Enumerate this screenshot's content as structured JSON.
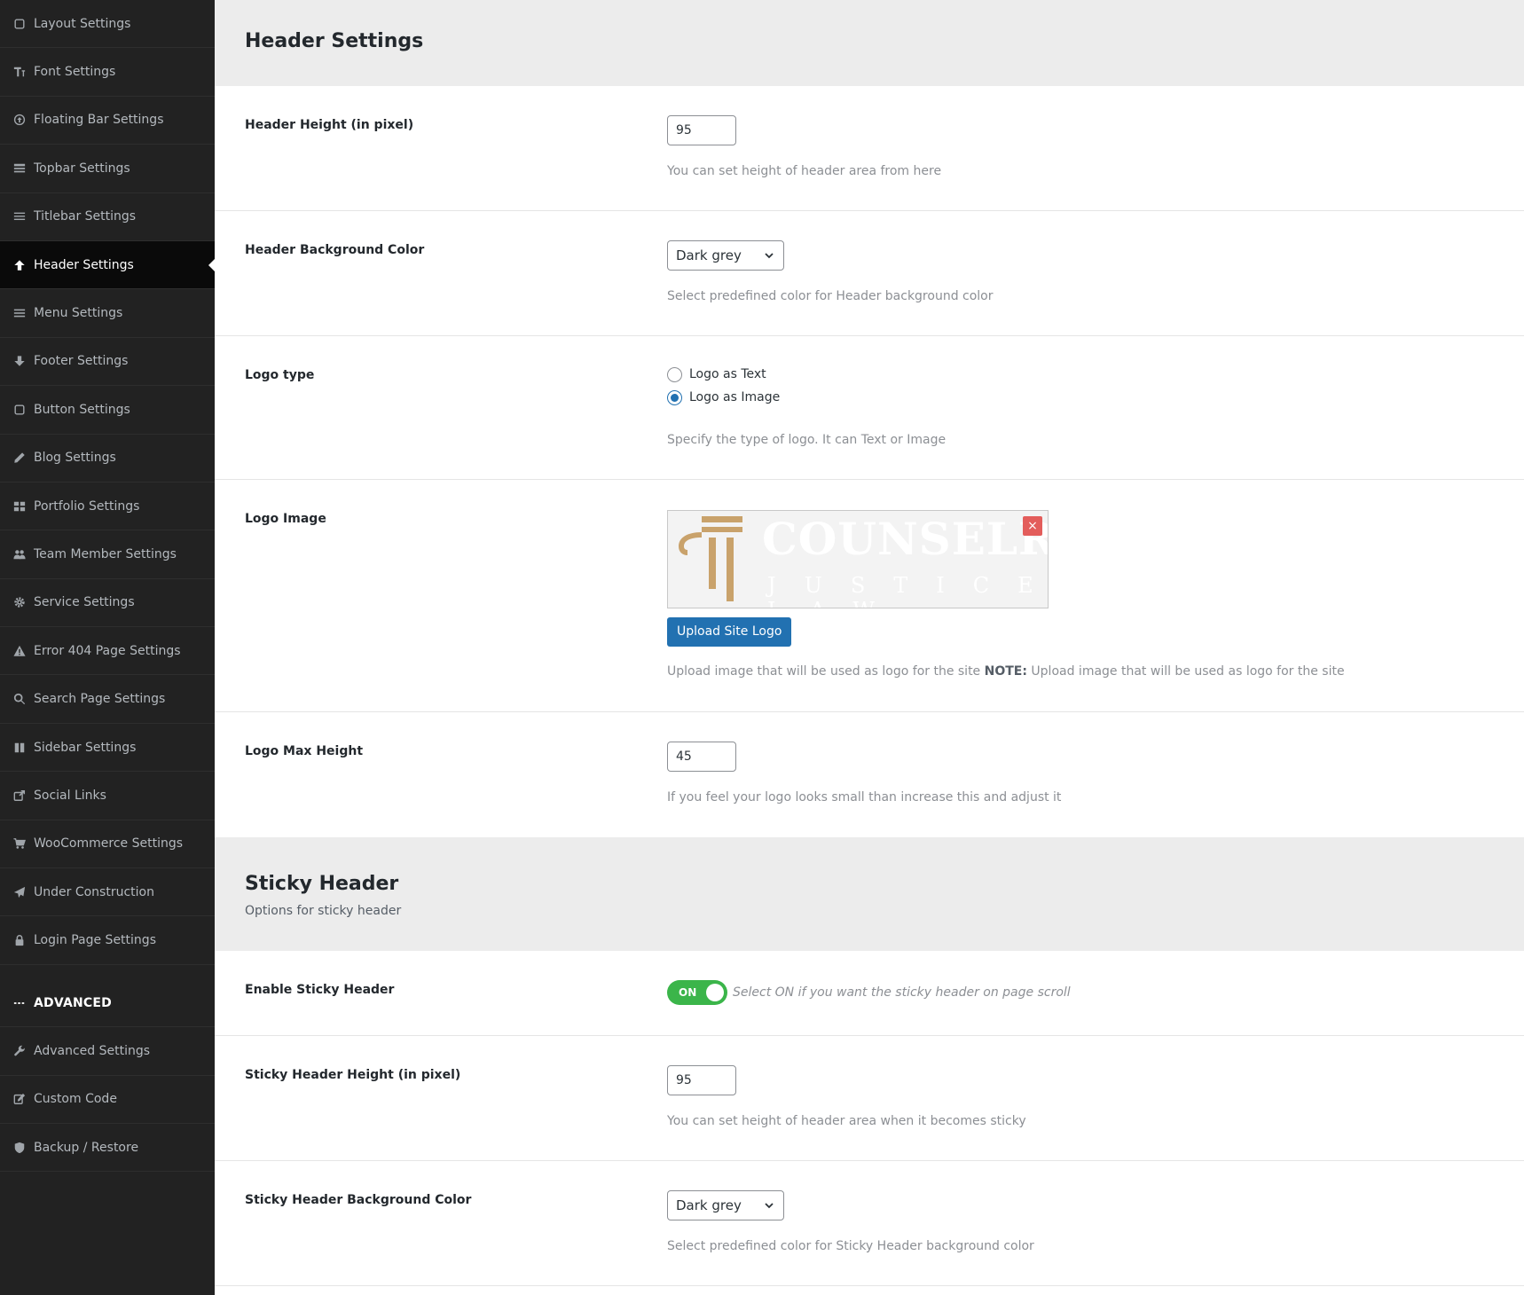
{
  "sidebar": {
    "items": [
      {
        "label": "Layout Settings",
        "icon": "square-icon"
      },
      {
        "label": "Font Settings",
        "icon": "text-icon"
      },
      {
        "label": "Floating Bar Settings",
        "icon": "arrow-circle-icon"
      },
      {
        "label": "Topbar Settings",
        "icon": "topbar-icon"
      },
      {
        "label": "Titlebar Settings",
        "icon": "list-icon"
      },
      {
        "label": "Header Settings",
        "icon": "arrow-up-icon",
        "active": true
      },
      {
        "label": "Menu Settings",
        "icon": "menu-icon"
      },
      {
        "label": "Footer Settings",
        "icon": "arrow-down-icon"
      },
      {
        "label": "Button Settings",
        "icon": "square-icon"
      },
      {
        "label": "Blog Settings",
        "icon": "pencil-icon"
      },
      {
        "label": "Portfolio Settings",
        "icon": "grid-icon"
      },
      {
        "label": "Team Member Settings",
        "icon": "users-icon"
      },
      {
        "label": "Service Settings",
        "icon": "gear-icon"
      },
      {
        "label": "Error 404 Page Settings",
        "icon": "warning-icon"
      },
      {
        "label": "Search Page Settings",
        "icon": "search-icon"
      },
      {
        "label": "Sidebar Settings",
        "icon": "columns-icon"
      },
      {
        "label": "Social Links",
        "icon": "share-icon"
      },
      {
        "label": "WooCommerce Settings",
        "icon": "cart-icon"
      },
      {
        "label": "Under Construction",
        "icon": "paper-plane-icon"
      },
      {
        "label": "Login Page Settings",
        "icon": "lock-icon"
      }
    ],
    "advanced_heading": "ADVANCED",
    "advanced_items": [
      {
        "label": "Advanced Settings",
        "icon": "wrench-icon"
      },
      {
        "label": "Custom Code",
        "icon": "edit-icon"
      },
      {
        "label": "Backup / Restore",
        "icon": "shield-icon"
      }
    ]
  },
  "header_section": {
    "title": "Header Settings",
    "header_height": {
      "label": "Header Height (in pixel)",
      "value": "95",
      "desc": "You can set height of header area from here"
    },
    "header_bg": {
      "label": "Header Background Color",
      "value": "Dark grey",
      "desc": "Select predefined color for Header background color"
    },
    "logo_type": {
      "label": "Logo type",
      "option_text": "Logo as Text",
      "option_image": "Logo as Image",
      "selected": "Logo as Image",
      "desc": "Specify the type of logo. It can Text or Image"
    },
    "logo_image": {
      "label": "Logo Image",
      "logo_word": "COUNSELR",
      "logo_sub": "JUSTICE LAW",
      "remove": "×",
      "upload_label": "Upload Site Logo",
      "desc": "Upload image that will be used as logo for the site",
      "note_label": "NOTE:",
      "note_text": "Upload image that will be used as logo for the site"
    },
    "logo_max_height": {
      "label": "Logo Max Height",
      "value": "45",
      "desc": "If you feel your logo looks small than increase this and adjust it"
    }
  },
  "sticky_section": {
    "title": "Sticky Header",
    "subtitle": "Options for sticky header",
    "enable": {
      "label": "Enable Sticky Header",
      "toggle_label": "ON",
      "desc": "Select ON if you want the sticky header on page scroll"
    },
    "height": {
      "label": "Sticky Header Height (in pixel)",
      "value": "95",
      "desc": "You can set height of header area when it becomes sticky"
    },
    "bg": {
      "label": "Sticky Header Background Color",
      "value": "Dark grey",
      "desc": "Select predefined color for Sticky Header background color"
    }
  },
  "colors": {
    "sidebar_bg": "#222222",
    "active_bg": "#0a0a0a",
    "primary": "#2271b1",
    "toggle_on": "#3bb54a",
    "logo_gold": "#c9a26b",
    "remove_red": "#e35d5b"
  }
}
